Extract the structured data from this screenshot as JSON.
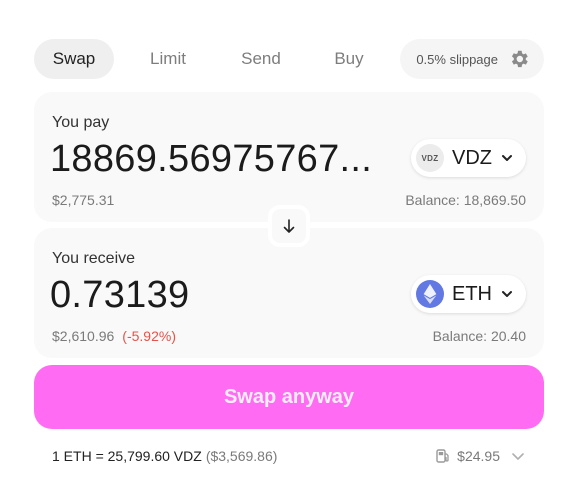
{
  "tabs": [
    {
      "label": "Swap",
      "active": true
    },
    {
      "label": "Limit",
      "active": false
    },
    {
      "label": "Send",
      "active": false
    },
    {
      "label": "Buy",
      "active": false
    }
  ],
  "slippage": {
    "label": "0.5% slippage",
    "icon": "gear-icon"
  },
  "pay": {
    "label": "You pay",
    "amount": "18869.56975767...",
    "usd_value": "$2,775.31",
    "balance": "Balance: 18,869.50",
    "token": {
      "symbol": "VDZ",
      "icon_text": "VDZ",
      "icon": "vdz-token-icon"
    }
  },
  "switch": {
    "icon": "arrow-down-icon"
  },
  "receive": {
    "label": "You receive",
    "amount": "0.73139",
    "usd_value": "$2,610.96",
    "price_impact": "(-5.92%)",
    "balance": "Balance: 20.40",
    "token": {
      "symbol": "ETH",
      "icon": "eth-token-icon"
    }
  },
  "cta": {
    "label": "Swap anyway"
  },
  "footer": {
    "rate": "1 ETH = 25,799.60 VDZ",
    "rate_usd": "($3,569.86)",
    "gas_fee": "$24.95",
    "gas_icon": "gas-pump-icon"
  },
  "colors": {
    "accent": "#ff6bf3",
    "negative": "#e5534b",
    "eth": "#6278e3",
    "panel_bg": "#f9f9f9"
  }
}
